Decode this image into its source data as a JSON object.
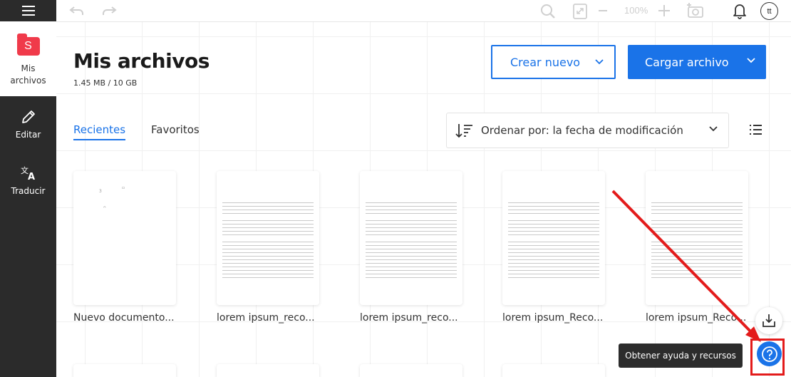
{
  "sidebar": {
    "items": [
      {
        "label": "Mis archivos"
      },
      {
        "label": "Editar"
      },
      {
        "label": "Traducir"
      }
    ],
    "logo_letter": "S"
  },
  "topbar": {
    "zoom": "100%",
    "avatar_initials": "tt"
  },
  "header": {
    "title": "Mis archivos",
    "storage": "1.45 MB / 10 GB",
    "create_label": "Crear nuevo",
    "upload_label": "Cargar archivo"
  },
  "tabs": [
    {
      "label": "Recientes",
      "active": true
    },
    {
      "label": "Favoritos",
      "active": false
    }
  ],
  "sort": {
    "label": "Ordenar por: la fecha de modificación"
  },
  "files": [
    {
      "name": "Nuevo documento...",
      "blank": true
    },
    {
      "name": "lorem ipsum_reco...",
      "blank": false
    },
    {
      "name": "lorem ipsum_reco...",
      "blank": false
    },
    {
      "name": "lorem ipsum_Reco...",
      "blank": false
    },
    {
      "name": "lorem ipsum_Reco...",
      "blank": false
    }
  ],
  "help": {
    "tooltip": "Obtener ayuda y recursos"
  },
  "colors": {
    "accent": "#1a73e8",
    "sidebar": "#2b2b2b",
    "logo": "#f03a4a",
    "highlight": "#e31b1b"
  }
}
